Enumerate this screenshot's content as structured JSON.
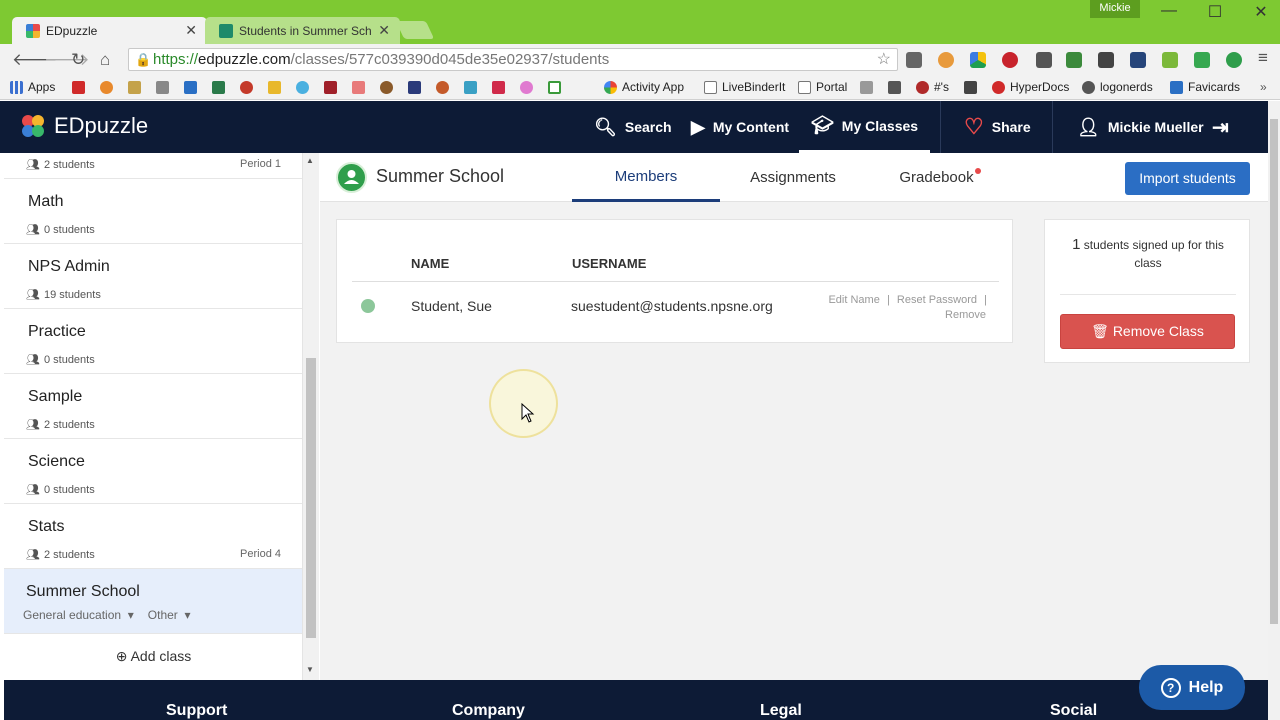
{
  "browser": {
    "user_chip": "Mickie",
    "tabs": [
      {
        "title": "EDpuzzle",
        "close": "✕"
      },
      {
        "title": "Students in Summer Scho",
        "close": "✕"
      }
    ],
    "url": {
      "scheme": "https://",
      "host": "edpuzzle.com",
      "path": "/classes/577c039390d045de35e02937/students"
    },
    "bookmarks": [
      "Apps",
      "Activity App",
      "LiveBinderIt",
      "Portal",
      "#'s",
      "HyperDocs",
      "logonerds",
      "Favicards"
    ]
  },
  "app": {
    "logo": "EDpuzzle",
    "nav": {
      "search": "Search",
      "my_content": "My Content",
      "my_classes": "My Classes",
      "share": "Share",
      "user": "Mickie Mueller"
    }
  },
  "sidebar": {
    "top_partial": {
      "students": "2 students",
      "period": "Period 1"
    },
    "classes": [
      {
        "name": "Math",
        "students": "0 students",
        "period": ""
      },
      {
        "name": "NPS Admin",
        "students": "19 students",
        "period": ""
      },
      {
        "name": "Practice",
        "students": "0 students",
        "period": ""
      },
      {
        "name": "Sample",
        "students": "2 students",
        "period": ""
      },
      {
        "name": "Science",
        "students": "0 students",
        "period": ""
      },
      {
        "name": "Stats",
        "students": "2 students",
        "period": "Period 4"
      }
    ],
    "selected": {
      "name": "Summer School",
      "subject": "General education",
      "grade": "Other"
    },
    "add_class": "Add class"
  },
  "main": {
    "class_title": "Summer School",
    "tabs": [
      "Members",
      "Assignments",
      "Gradebook"
    ],
    "import_button": "Import students",
    "table": {
      "headers": [
        "NAME",
        "USERNAME"
      ],
      "rows": [
        {
          "name": "Student, Sue",
          "username": "suestudent@students.npsne.org"
        }
      ],
      "row_actions": [
        "Edit Name",
        "Reset Password",
        "Remove"
      ]
    },
    "summary": {
      "count": "1",
      "text": "students signed up for this class"
    },
    "remove_button": "Remove Class"
  },
  "footer": {
    "columns": [
      "Support",
      "Company",
      "Legal",
      "Social"
    ]
  },
  "help": {
    "label": "Help"
  }
}
